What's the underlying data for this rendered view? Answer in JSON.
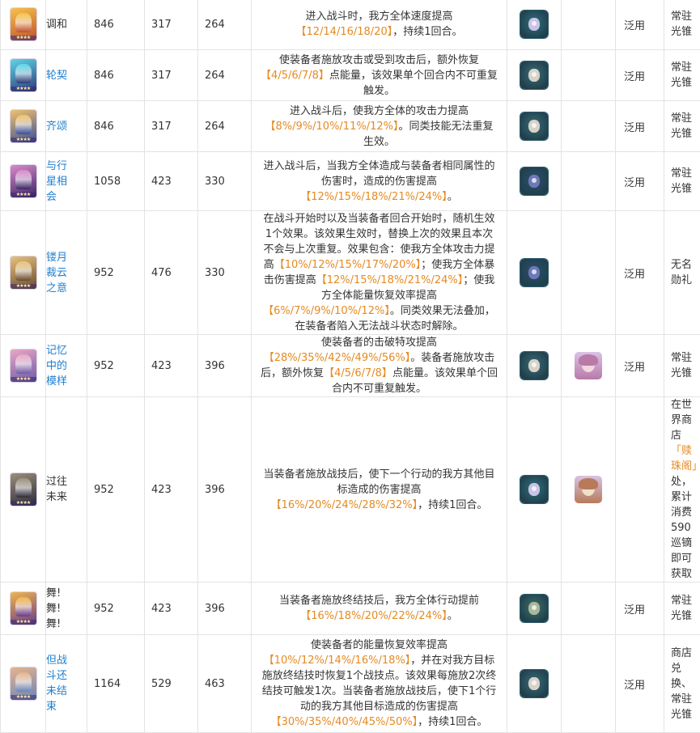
{
  "rows": [
    {
      "name": "调和",
      "link": false,
      "atk": "846",
      "hp": "317",
      "def": "264",
      "desc": [
        {
          "t": "进入战斗时，我方全体速度提高"
        },
        {
          "t": "【12/14/16/18/20】",
          "h": true
        },
        {
          "t": "，持续1回合。"
        }
      ],
      "material_icon": "bug-creature-icon",
      "has_char": false,
      "char_icon": "",
      "type": "泛用",
      "source": [
        {
          "t": "常驻光锥"
        }
      ],
      "card_colors": [
        "#f6c24b",
        "#c0512c"
      ],
      "tile_colors": [
        "#2f6f80",
        "#c9c3e6"
      ],
      "char_colors": []
    },
    {
      "name": "轮契",
      "link": true,
      "atk": "846",
      "hp": "317",
      "def": "264",
      "desc": [
        {
          "t": "使装备者施放攻击或受到攻击后，额外恢复"
        },
        {
          "t": "【4/5/6/7/8】",
          "h": true
        },
        {
          "t": "点能量，该效果单个回合内不可重复触发。"
        }
      ],
      "material_icon": "gear-part-icon",
      "has_char": false,
      "char_icon": "",
      "type": "泛用",
      "source": [
        {
          "t": "常驻光锥"
        }
      ],
      "card_colors": [
        "#5fd5e6",
        "#2a3b7a"
      ],
      "tile_colors": [
        "#3b6c79",
        "#d8d2c8"
      ],
      "char_colors": []
    },
    {
      "name": "齐颂",
      "link": true,
      "atk": "846",
      "hp": "317",
      "def": "264",
      "desc": [
        {
          "t": "进入战斗后，使我方全体的攻击力提高"
        },
        {
          "t": "【8%/9%/10%/11%/12%】",
          "h": true
        },
        {
          "t": "。同类技能无法重复生效。"
        }
      ],
      "material_icon": "gear-part-icon",
      "has_char": false,
      "char_icon": "",
      "type": "泛用",
      "source": [
        {
          "t": "常驻光锥"
        }
      ],
      "card_colors": [
        "#f0c16a",
        "#3a4f9a"
      ],
      "tile_colors": [
        "#3b6c79",
        "#d8d2c8"
      ],
      "char_colors": []
    },
    {
      "name": "与行星相会",
      "link": true,
      "atk": "1058",
      "hp": "423",
      "def": "330",
      "desc": [
        {
          "t": "进入战斗后，当我方全体造成与装备者相同属性的伤害时，造成的伤害提高"
        },
        {
          "t": "【12%/15%/18%/21%/24%】",
          "h": true
        },
        {
          "t": "。"
        }
      ],
      "material_icon": "crystal-shard-icon",
      "has_char": false,
      "char_icon": "",
      "type": "泛用",
      "source": [
        {
          "t": "常驻光锥"
        }
      ],
      "card_colors": [
        "#d98ac9",
        "#3b2466"
      ],
      "tile_colors": [
        "#2c4f6f",
        "#6d79b8"
      ],
      "char_colors": []
    },
    {
      "name": "镂月裁云之意",
      "link": true,
      "atk": "952",
      "hp": "476",
      "def": "330",
      "desc": [
        {
          "t": "在战斗开始时以及当装备者回合开始时，随机生效1个效果。该效果生效时，替换上次的效果且本次不会与上次重复。效果包含：使我方全体攻击力提高"
        },
        {
          "t": "【10%/12%/15%/17%/20%】",
          "h": true
        },
        {
          "t": "；使我方全体暴击伤害提高"
        },
        {
          "t": "【12%/15%/18%/21%/24%】",
          "h": true
        },
        {
          "t": "；使我方全体能量恢复效率提高"
        },
        {
          "t": "【6%/7%/9%/10%/12%】",
          "h": true
        },
        {
          "t": "。同类效果无法叠加，在装备者陷入无法战斗状态时解除。"
        }
      ],
      "material_icon": "crystal-shard-icon",
      "has_char": false,
      "char_icon": "",
      "type": "泛用",
      "source": [
        {
          "t": "无名勋礼"
        }
      ],
      "card_colors": [
        "#e7c27a",
        "#6a4b2e"
      ],
      "tile_colors": [
        "#2c4f6f",
        "#6d79b8"
      ],
      "char_colors": []
    },
    {
      "name": "记忆中的模样",
      "link": true,
      "atk": "952",
      "hp": "423",
      "def": "396",
      "desc": [
        {
          "t": "使装备者的击破特攻提高"
        },
        {
          "t": "【28%/35%/42%/49%/56%】",
          "h": true
        },
        {
          "t": "。装备者施放攻击后，额外恢复"
        },
        {
          "t": "【4/5/6/7/8】",
          "h": true
        },
        {
          "t": "点能量。该效果单个回合内不可重复触发。"
        }
      ],
      "material_icon": "gear-part-icon",
      "has_char": true,
      "char_icon": "march-7th-portrait",
      "type": "泛用",
      "source": [
        {
          "t": "常驻光锥"
        }
      ],
      "card_colors": [
        "#e8a7c4",
        "#6f5aa6"
      ],
      "tile_colors": [
        "#3b6c79",
        "#d8d2c8"
      ],
      "char_colors": [
        "#b97aa8",
        "#f3d6de"
      ]
    },
    {
      "name": "过往未来",
      "link": false,
      "atk": "952",
      "hp": "423",
      "def": "396",
      "desc": [
        {
          "t": "当装备者施放战技后，使下一个行动的我方其他目标造成的伤害提高"
        },
        {
          "t": "【16%/20%/24%/28%/32%】",
          "h": true
        },
        {
          "t": "，持续1回合。"
        }
      ],
      "material_icon": "bug-creature-icon",
      "has_char": true,
      "char_icon": "tingyun-portrait",
      "type": "",
      "source": [
        {
          "t": "在世界商店"
        },
        {
          "t": "「赎珠阁」",
          "h": true
        },
        {
          "t": "处，累计消费590巡镝即可获取"
        }
      ],
      "card_colors": [
        "#9a8f7a",
        "#2c2a3a"
      ],
      "tile_colors": [
        "#2f6f80",
        "#c9c3e6"
      ],
      "char_colors": [
        "#b97a5a",
        "#efe0c8"
      ]
    },
    {
      "name": "舞!舞!舞!",
      "link": false,
      "atk": "952",
      "hp": "423",
      "def": "396",
      "desc": [
        {
          "t": "当装备者施放终结技后，我方全体行动提前"
        },
        {
          "t": "【16%/18%/20%/22%/24%】",
          "h": true
        },
        {
          "t": "。"
        }
      ],
      "material_icon": "machine-block-icon",
      "has_char": false,
      "char_icon": "",
      "type": "泛用",
      "source": [
        {
          "t": "常驻光锥"
        }
      ],
      "card_colors": [
        "#f0b54a",
        "#6a3a8a"
      ],
      "tile_colors": [
        "#3f6f6a",
        "#a9b89a"
      ],
      "char_colors": []
    },
    {
      "name": "但战斗还未结束",
      "link": true,
      "atk": "1164",
      "hp": "529",
      "def": "463",
      "desc": [
        {
          "t": "使装备者的能量恢复效率提高"
        },
        {
          "t": "【10%/12%/14%/16%/18%】",
          "h": true
        },
        {
          "t": "，并在对我方目标施放终结技时恢复1个战技点。该效果每施放2次终结技可触发1次。当装备者施放战技后，使下1个行动的我方其他目标造成的伤害提高"
        },
        {
          "t": "【30%/35%/40%/45%/50%】",
          "h": true
        },
        {
          "t": "，持续1回合。"
        }
      ],
      "material_icon": "gear-part-icon",
      "has_char": false,
      "char_icon": "",
      "type": "泛用",
      "source": [
        {
          "t": "商店兑换、常驻光锥"
        }
      ],
      "card_colors": [
        "#e7b48a",
        "#6b84b8"
      ],
      "tile_colors": [
        "#3b6c79",
        "#d8d2c8"
      ],
      "char_colors": []
    }
  ]
}
